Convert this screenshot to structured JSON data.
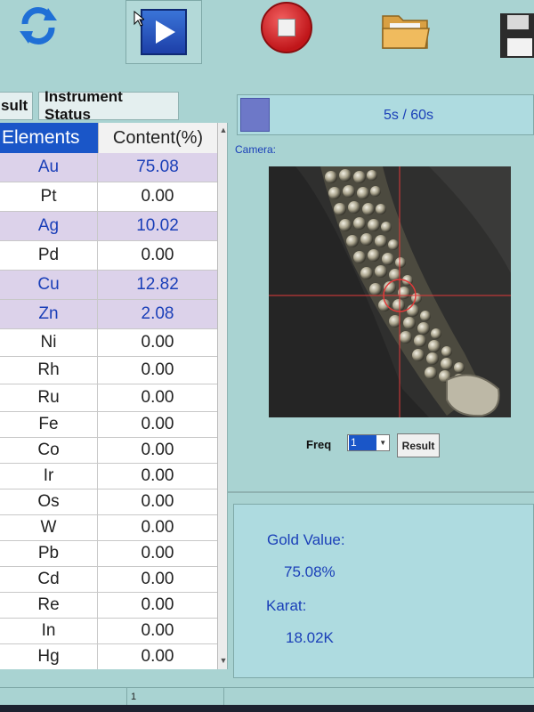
{
  "toolbar": {
    "icons": [
      "refresh-icon",
      "play-icon",
      "stop-icon",
      "folder-icon",
      "save-icon"
    ]
  },
  "tabs": [
    {
      "label": "sult"
    },
    {
      "label": "Instrument Status"
    }
  ],
  "table": {
    "headers": {
      "element": "Elements",
      "content": "Content(%)"
    },
    "rows": [
      {
        "element": "Au",
        "content": "75.08",
        "highlight": true
      },
      {
        "element": "Pt",
        "content": "0.00",
        "highlight": false
      },
      {
        "element": "Ag",
        "content": "10.02",
        "highlight": true
      },
      {
        "element": "Pd",
        "content": "0.00",
        "highlight": false
      },
      {
        "element": "Cu",
        "content": "12.82",
        "highlight": true
      },
      {
        "element": "Zn",
        "content": "2.08",
        "highlight": true
      },
      {
        "element": "Ni",
        "content": "0.00",
        "highlight": false
      },
      {
        "element": "Rh",
        "content": "0.00",
        "highlight": false
      },
      {
        "element": "Ru",
        "content": "0.00",
        "highlight": false
      },
      {
        "element": "Fe",
        "content": "0.00",
        "highlight": false
      },
      {
        "element": "Co",
        "content": "0.00",
        "highlight": false
      },
      {
        "element": "Ir",
        "content": "0.00",
        "highlight": false
      },
      {
        "element": "Os",
        "content": "0.00",
        "highlight": false
      },
      {
        "element": "W",
        "content": "0.00",
        "highlight": false
      },
      {
        "element": "Pb",
        "content": "0.00",
        "highlight": false
      },
      {
        "element": "Cd",
        "content": "0.00",
        "highlight": false
      },
      {
        "element": "Re",
        "content": "0.00",
        "highlight": false
      },
      {
        "element": "In",
        "content": "0.00",
        "highlight": false
      },
      {
        "element": "Hg",
        "content": "0.00",
        "highlight": false
      }
    ]
  },
  "progress": {
    "text": "5s / 60s",
    "fraction": 0.083
  },
  "camera": {
    "label": "Camera:"
  },
  "freq": {
    "label": "Freq",
    "value": "1"
  },
  "result_button": {
    "label": "Result"
  },
  "gold": {
    "value_label": "Gold Value:",
    "value": "75.08%",
    "karat_label": "Karat:",
    "karat": "18.02K"
  },
  "statusbar": {
    "page": "1"
  },
  "colors": {
    "background": "#a9d3d2",
    "header_blue": "#1a56c8",
    "highlight_row": "#dcd2ea",
    "text_blue": "#1a3fb8"
  }
}
